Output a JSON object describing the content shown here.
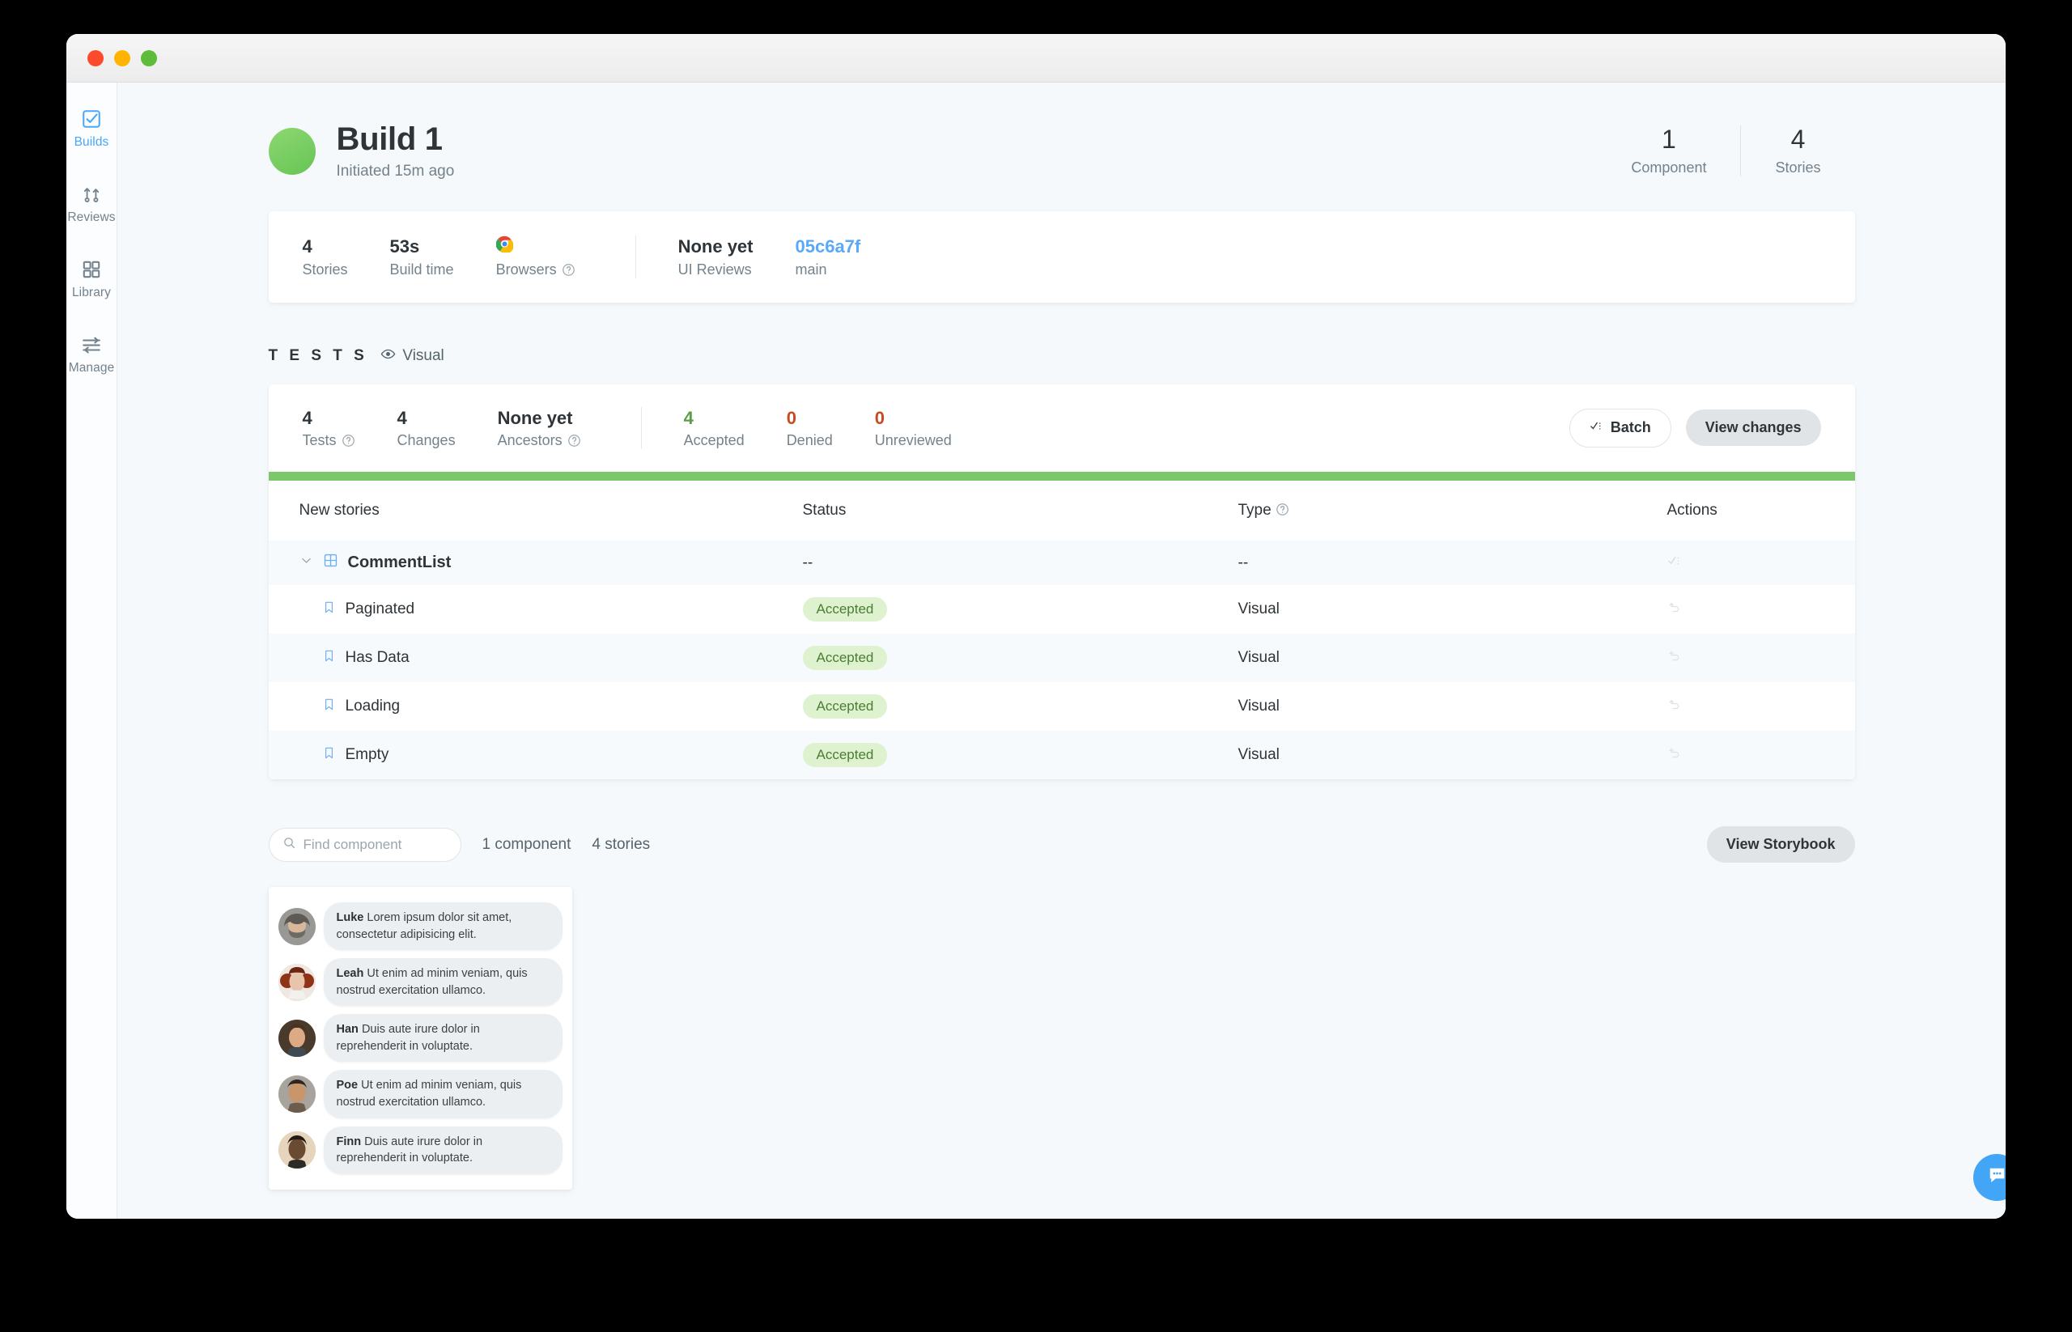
{
  "window": {
    "traffic_lights": [
      "close",
      "minimize",
      "zoom"
    ]
  },
  "sidebar": {
    "items": [
      {
        "label": "Builds",
        "icon": "checkbox-check-icon",
        "active": true
      },
      {
        "label": "Reviews",
        "icon": "branch-merge-icon",
        "active": false
      },
      {
        "label": "Library",
        "icon": "grid-squares-icon",
        "active": false
      },
      {
        "label": "Manage",
        "icon": "sliders-icon",
        "active": false
      }
    ]
  },
  "header": {
    "avatar_color": "#6fc957",
    "title": "Build 1",
    "subtitle": "Initiated 15m ago",
    "counts": [
      {
        "value": "1",
        "label": "Component"
      },
      {
        "value": "4",
        "label": "Stories"
      }
    ]
  },
  "summary": {
    "stats": [
      {
        "value": "4",
        "label": "Stories",
        "help": false
      },
      {
        "value": "53s",
        "label": "Build time",
        "help": false
      },
      {
        "value": "",
        "label": "Browsers",
        "help": true,
        "icon": "chrome-icon"
      }
    ],
    "right_stats": [
      {
        "value": "None yet",
        "label": "UI Reviews",
        "link": false
      },
      {
        "value": "05c6a7f",
        "label": "main",
        "link": true
      }
    ]
  },
  "tests": {
    "section_label": "T E S T S",
    "mode_label": "Visual",
    "mode_icon": "eye-icon",
    "stats": [
      {
        "value": "4",
        "label": "Tests",
        "help": true,
        "tone": "dark"
      },
      {
        "value": "4",
        "label": "Changes",
        "help": false,
        "tone": "dark"
      },
      {
        "value": "None yet",
        "label": "Ancestors",
        "help": true,
        "tone": "dark"
      }
    ],
    "review_stats": [
      {
        "value": "4",
        "label": "Accepted",
        "tone": "green"
      },
      {
        "value": "0",
        "label": "Denied",
        "tone": "red"
      },
      {
        "value": "0",
        "label": "Unreviewed",
        "tone": "red"
      }
    ],
    "batch_button": "Batch",
    "batch_icon": "check-list-icon",
    "view_changes_button": "View changes",
    "progress_color": "#7bc86c",
    "table": {
      "columns": [
        {
          "label": "New stories",
          "help": false
        },
        {
          "label": "Status",
          "help": false
        },
        {
          "label": "Type",
          "help": true
        },
        {
          "label": "Actions",
          "help": false
        }
      ],
      "rows": [
        {
          "kind": "component",
          "name": "CommentList",
          "icon": "component-grid-icon",
          "chevron": "chevron-down-icon",
          "status": "--",
          "type": "--",
          "action_icon": "check-list-icon"
        },
        {
          "kind": "story",
          "name": "Paginated",
          "icon": "bookmark-icon",
          "status": "Accepted",
          "type": "Visual",
          "action_icon": "undo-icon"
        },
        {
          "kind": "story",
          "name": "Has Data",
          "icon": "bookmark-icon",
          "status": "Accepted",
          "type": "Visual",
          "action_icon": "undo-icon"
        },
        {
          "kind": "story",
          "name": "Loading",
          "icon": "bookmark-icon",
          "status": "Accepted",
          "type": "Visual",
          "action_icon": "undo-icon"
        },
        {
          "kind": "story",
          "name": "Empty",
          "icon": "bookmark-icon",
          "status": "Accepted",
          "type": "Visual",
          "action_icon": "undo-icon"
        }
      ]
    }
  },
  "explorer": {
    "search_placeholder": "Find component",
    "search_value": "",
    "search_icon": "search-icon",
    "component_count": "1 component",
    "story_count": "4 stories",
    "view_storybook_button": "View Storybook"
  },
  "preview": {
    "comments": [
      {
        "author": "Luke",
        "text": "Lorem ipsum dolor sit amet, consectetur adipisicing elit.",
        "avatar_color": "#8e8d8a"
      },
      {
        "author": "Leah",
        "text": "Ut enim ad minim veniam, quis nostrud exercitation ullamco.",
        "avatar_color": "#a6543c"
      },
      {
        "author": "Han",
        "text": "Duis aute irure dolor in reprehenderit in voluptate.",
        "avatar_color": "#8d6a4f"
      },
      {
        "author": "Poe",
        "text": "Ut enim ad minim veniam, quis nostrud exercitation ullamco.",
        "avatar_color": "#7c6a5c"
      },
      {
        "author": "Finn",
        "text": "Duis aute irure dolor in reprehenderit in voluptate.",
        "avatar_color": "#5a4436"
      }
    ]
  },
  "chat": {
    "icon": "chat-bubble-icon",
    "color": "#43a5f5"
  }
}
